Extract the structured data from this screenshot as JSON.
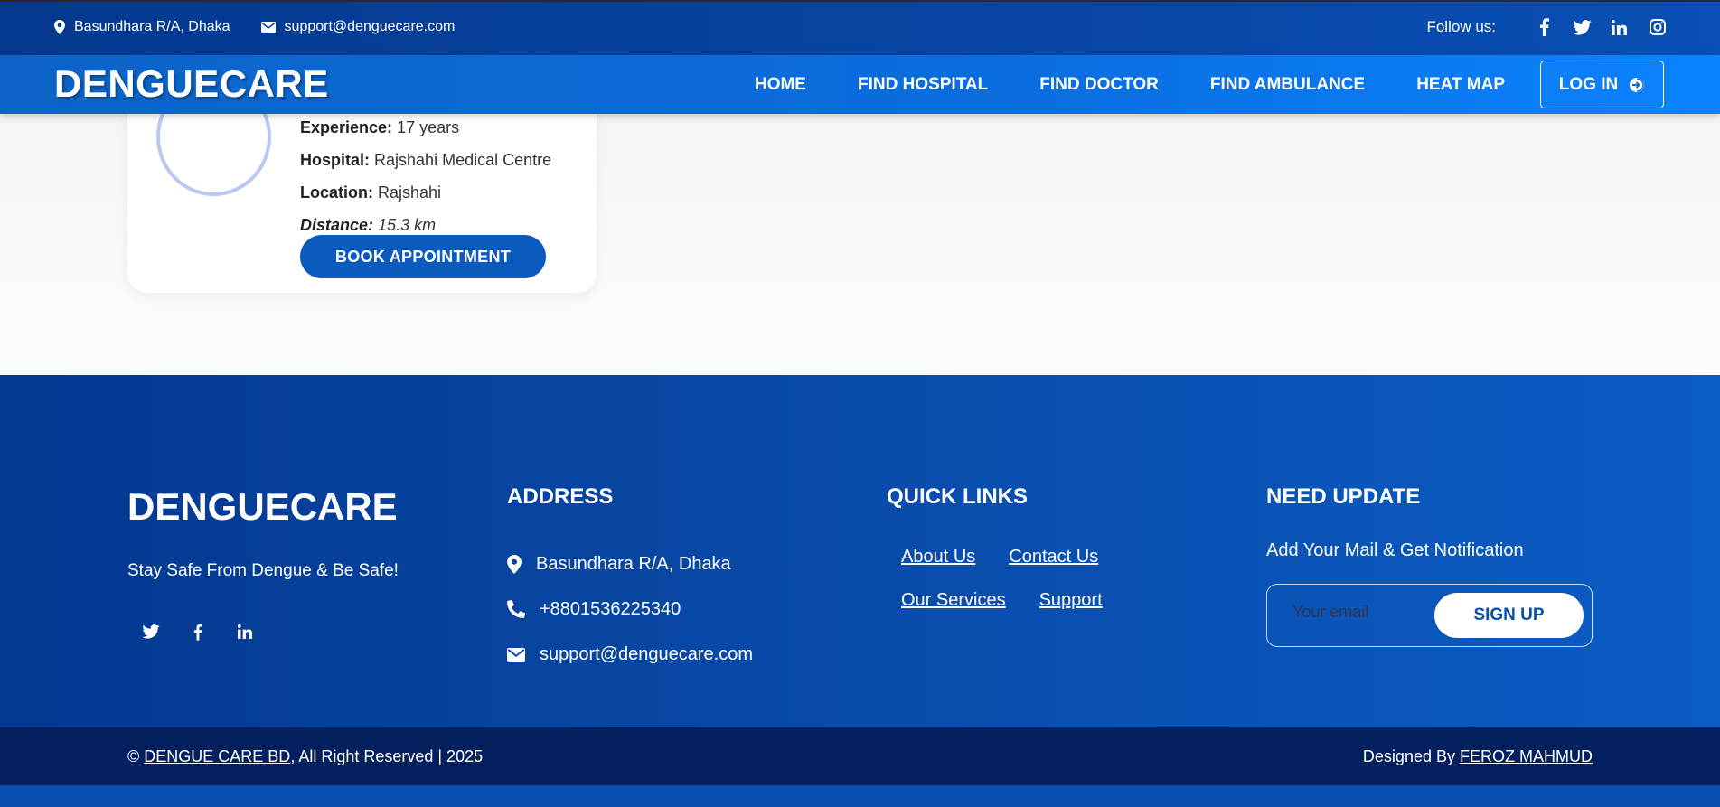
{
  "topbar": {
    "address": "Basundhara R/A, Dhaka",
    "email": "support@denguecare.com",
    "follow_label": "Follow us:",
    "social_icons": [
      "facebook-icon",
      "twitter-icon",
      "linkedin-icon",
      "instagram-icon"
    ]
  },
  "navbar": {
    "brand": "DENGUECARE",
    "links": [
      "HOME",
      "FIND HOSPITAL",
      "FIND DOCTOR",
      "FIND AMBULANCE",
      "HEAT MAP"
    ],
    "login": "LOG IN"
  },
  "doctor_card": {
    "experience_label": "Experience:",
    "experience_value": "17 years",
    "hospital_label": "Hospital:",
    "hospital_value": "Rajshahi Medical Centre",
    "location_label": "Location:",
    "location_value": "Rajshahi",
    "distance_label": "Distance:",
    "distance_value": "15.3 km",
    "button": "BOOK APPOINTMENT"
  },
  "footer": {
    "brand": "DENGUECARE",
    "tagline": "Stay Safe From Dengue & Be Safe!",
    "address_heading": "ADDRESS",
    "address": "Basundhara R/A, Dhaka",
    "phone": "+8801536225340",
    "email": "support@denguecare.com",
    "quick_links_heading": "QUICK LINKS",
    "quick_links": [
      "About Us",
      "Contact Us",
      "Our Services",
      "Support"
    ],
    "update_heading": "NEED UPDATE",
    "update_text": "Add Your Mail & Get Notification",
    "email_placeholder": "Your email",
    "signup": "SIGN UP"
  },
  "bottom": {
    "copyright_symbol": "©",
    "company_link": "DENGUE CARE BD",
    "rights": ", All Right Reserved | 2025",
    "designed_by": "Designed By",
    "designer": "FEROZ MAHMUD"
  },
  "colors": {
    "primary_dark": "#04388f",
    "primary": "#0a5bbd",
    "nav_bright": "#0b83ff",
    "footer_bottom": "#04205f"
  }
}
